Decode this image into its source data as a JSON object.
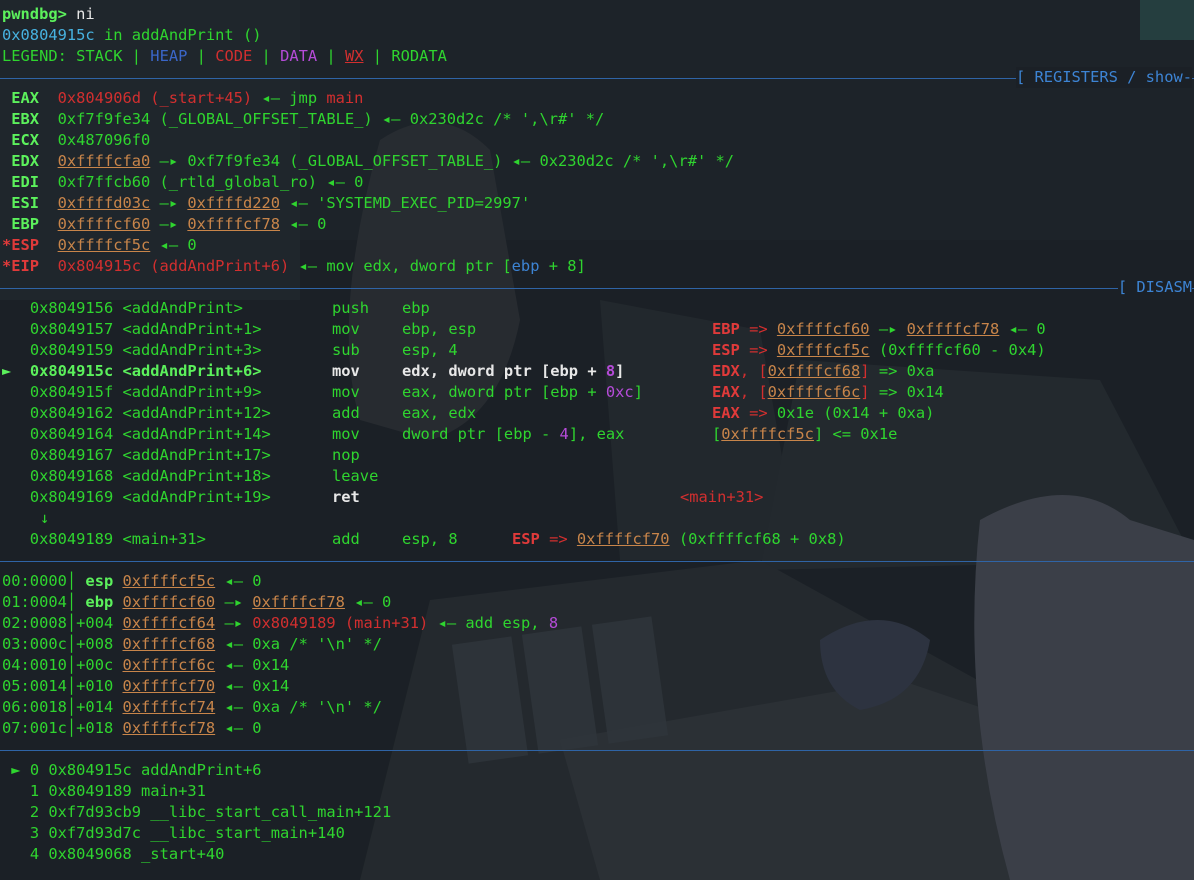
{
  "colors": {
    "stack": "#c8854a",
    "heap": "#3a66c8",
    "code": "#d22f2f",
    "data": "#b54bd8",
    "rodata": "#2fd52f",
    "separator": "#2f64a6",
    "background": "#1a1f24"
  },
  "prompt": {
    "text": "pwndbg> ",
    "command": "ni"
  },
  "location": {
    "addr": "0x0804915c",
    "in": " in ",
    "func": "addAndPrint ()"
  },
  "legend": {
    "label": "LEGEND: ",
    "stack": "STACK",
    "heap": "HEAP",
    "code": "CODE",
    "data": "DATA",
    "wx": "WX",
    "rodata": "RODATA",
    "sep": " | "
  },
  "sections": {
    "registers": "[ REGISTERS / show-",
    "disasm": "[ DISASM"
  },
  "registers": [
    {
      "name": " EAX  ",
      "parts": [
        [
          "r",
          "0x804906d (_start+45)"
        ],
        [
          "g",
          " ◂— "
        ],
        [
          "g",
          "jmp "
        ],
        [
          "r",
          "main"
        ]
      ]
    },
    {
      "name": " EBX  ",
      "parts": [
        [
          "g",
          "0xf7f9fe34 (_GLOBAL_OFFSET_TABLE_) ◂— 0x230d2c /* ',\\r#' */"
        ]
      ]
    },
    {
      "name": " ECX  ",
      "parts": [
        [
          "g",
          "0x487096f0"
        ]
      ]
    },
    {
      "name": " EDX  ",
      "parts": [
        [
          "o",
          "0xffffcfa0"
        ],
        [
          "g",
          " —▸ 0xf7f9fe34 (_GLOBAL_OFFSET_TABLE_) ◂— 0x230d2c /* ',\\r#' */"
        ]
      ]
    },
    {
      "name": " EDI  ",
      "parts": [
        [
          "g",
          "0xf7ffcb60 (_rtld_global_ro) ◂— 0"
        ]
      ]
    },
    {
      "name": " ESI  ",
      "parts": [
        [
          "o",
          "0xffffd03c"
        ],
        [
          "g",
          " —▸ "
        ],
        [
          "o",
          "0xffffd220"
        ],
        [
          "g",
          " ◂— 'SYSTEMD_EXEC_PID=2997'"
        ]
      ]
    },
    {
      "name": " EBP  ",
      "parts": [
        [
          "o",
          "0xffffcf60"
        ],
        [
          "g",
          " —▸ "
        ],
        [
          "o",
          "0xffffcf78"
        ],
        [
          "g",
          " ◂— 0"
        ]
      ]
    },
    {
      "name": "*ESP  ",
      "changed": true,
      "parts": [
        [
          "o",
          "0xffffcf5c"
        ],
        [
          "g",
          " ◂— 0"
        ]
      ]
    },
    {
      "name": "*EIP  ",
      "changed": true,
      "parts": [
        [
          "r",
          "0x804915c (addAndPrint+6)"
        ],
        [
          "g",
          " ◂— mov edx, dword ptr ["
        ],
        [
          "b",
          "ebp"
        ],
        [
          "g",
          " + 8]"
        ]
      ]
    }
  ],
  "disasm": [
    {
      "arrow": "  ",
      "addr": "0x8049156",
      "sym": "<addAndPrint>",
      "op": "push",
      "args": [
        [
          "g",
          "ebp"
        ]
      ],
      "note": []
    },
    {
      "arrow": "  ",
      "addr": "0x8049157",
      "sym": "<addAndPrint+1>",
      "op": "mov",
      "args": [
        [
          "g",
          "ebp, esp"
        ]
      ],
      "note": [
        [
          "rb",
          "EBP"
        ],
        [
          "r",
          " => "
        ],
        [
          "o",
          "0xffffcf60"
        ],
        [
          "g",
          " —▸ "
        ],
        [
          "o",
          "0xffffcf78"
        ],
        [
          "g",
          " ◂— 0"
        ]
      ]
    },
    {
      "arrow": "  ",
      "addr": "0x8049159",
      "sym": "<addAndPrint+3>",
      "op": "sub",
      "args": [
        [
          "g",
          "esp, 4"
        ]
      ],
      "note": [
        [
          "rb",
          "ESP"
        ],
        [
          "r",
          " => "
        ],
        [
          "o",
          "0xffffcf5c"
        ],
        [
          "g",
          " (0xffffcf60 - 0x4)"
        ]
      ]
    },
    {
      "arrow": "► ",
      "current": true,
      "addr": "0x804915c",
      "sym": "<addAndPrint+6>",
      "op": "mov",
      "args": [
        [
          "w",
          "edx, dword ptr ["
        ],
        [
          "w",
          "ebp"
        ],
        [
          "w",
          " + "
        ],
        [
          "pu",
          "8"
        ],
        [
          "w",
          "]"
        ]
      ],
      "note": [
        [
          "rb",
          "EDX"
        ],
        [
          "r",
          ", ["
        ],
        [
          "o",
          "0xffffcf68"
        ],
        [
          "r",
          "]"
        ],
        [
          "g",
          " => 0xa"
        ]
      ]
    },
    {
      "arrow": "  ",
      "addr": "0x804915f",
      "sym": "<addAndPrint+9>",
      "op": "mov",
      "args": [
        [
          "g",
          "eax, dword ptr ["
        ],
        [
          "g",
          "ebp"
        ],
        [
          "g",
          " + "
        ],
        [
          "pu",
          "0xc"
        ],
        [
          "g",
          "]"
        ]
      ],
      "note": [
        [
          "rb",
          "EAX"
        ],
        [
          "r",
          ", ["
        ],
        [
          "o",
          "0xffffcf6c"
        ],
        [
          "r",
          "]"
        ],
        [
          "g",
          " => 0x14"
        ]
      ]
    },
    {
      "arrow": "  ",
      "addr": "0x8049162",
      "sym": "<addAndPrint+12>",
      "op": "add",
      "args": [
        [
          "g",
          "eax, edx"
        ]
      ],
      "note": [
        [
          "rb",
          "EAX"
        ],
        [
          "r",
          " => "
        ],
        [
          "g",
          "0x1e (0x14 + 0xa)"
        ]
      ]
    },
    {
      "arrow": "  ",
      "addr": "0x8049164",
      "sym": "<addAndPrint+14>",
      "op": "mov",
      "args": [
        [
          "g",
          "dword ptr [ebp - "
        ],
        [
          "pu",
          "4"
        ],
        [
          "g",
          "], eax"
        ]
      ],
      "note": [
        [
          "g",
          "["
        ],
        [
          "o",
          "0xffffcf5c"
        ],
        [
          "g",
          "] <= 0x1e"
        ]
      ]
    },
    {
      "arrow": "  ",
      "addr": "0x8049167",
      "sym": "<addAndPrint+17>",
      "op": "nop",
      "args": [],
      "note": []
    },
    {
      "arrow": "  ",
      "addr": "0x8049168",
      "sym": "<addAndPrint+18>",
      "op": "leave",
      "args": [],
      "note": []
    },
    {
      "arrow": "  ",
      "addr": "0x8049169",
      "sym": "<addAndPrint+19>",
      "op": "ret",
      "bold": true,
      "args": [],
      "note": [
        [
          "r",
          "<main+31>"
        ]
      ],
      "noteAt": 680
    }
  ],
  "jump_arrow": "↓",
  "jump_line": {
    "addr": "0x8049189",
    "sym": "<main+31>",
    "op": "add",
    "args": "esp, 8",
    "note": [
      [
        "rb",
        "ESP"
      ],
      [
        "r",
        " => "
      ],
      [
        "o",
        "0xffffcf70"
      ],
      [
        "g",
        " (0xffffcf68 + 0x8)"
      ]
    ]
  },
  "stack": [
    {
      "idx": "00:0000",
      "off": " esp ",
      "reg": true,
      "parts": [
        [
          "o",
          "0xffffcf5c"
        ],
        [
          "g",
          " ◂— 0"
        ]
      ]
    },
    {
      "idx": "01:0004",
      "off": " ebp ",
      "reg": true,
      "parts": [
        [
          "o",
          "0xffffcf60"
        ],
        [
          "g",
          " —▸ "
        ],
        [
          "o",
          "0xffffcf78"
        ],
        [
          "g",
          " ◂— 0"
        ]
      ]
    },
    {
      "idx": "02:0008",
      "off": "+004 ",
      "parts": [
        [
          "o",
          "0xffffcf64"
        ],
        [
          "g",
          " —▸ "
        ],
        [
          "r",
          "0x8049189 (main+31)"
        ],
        [
          "g",
          " ◂— add "
        ],
        [
          "g",
          "esp"
        ],
        [
          "g",
          ", "
        ],
        [
          "pu",
          "8"
        ]
      ]
    },
    {
      "idx": "03:000c",
      "off": "+008 ",
      "parts": [
        [
          "o",
          "0xffffcf68"
        ],
        [
          "g",
          " ◂— 0xa /* '\\n' */"
        ]
      ]
    },
    {
      "idx": "04:0010",
      "off": "+00c ",
      "parts": [
        [
          "o",
          "0xffffcf6c"
        ],
        [
          "g",
          " ◂— 0x14"
        ]
      ]
    },
    {
      "idx": "05:0014",
      "off": "+010 ",
      "parts": [
        [
          "o",
          "0xffffcf70"
        ],
        [
          "g",
          " ◂— 0x14"
        ]
      ]
    },
    {
      "idx": "06:0018",
      "off": "+014 ",
      "parts": [
        [
          "o",
          "0xffffcf74"
        ],
        [
          "g",
          " ◂— 0xa /* '\\n' */"
        ]
      ]
    },
    {
      "idx": "07:001c",
      "off": "+018 ",
      "parts": [
        [
          "o",
          "0xffffcf78"
        ],
        [
          "g",
          " ◂— 0"
        ]
      ]
    }
  ],
  "backtrace": [
    {
      "arrow": " ► ",
      "n": "0",
      "addr": "0x804915c",
      "sym": "addAndPrint+6"
    },
    {
      "arrow": "   ",
      "n": "1",
      "addr": "0x8049189",
      "sym": "main+31"
    },
    {
      "arrow": "   ",
      "n": "2",
      "addr": "0xf7d93cb9",
      "sym": "__libc_start_call_main+121"
    },
    {
      "arrow": "   ",
      "n": "3",
      "addr": "0xf7d93d7c",
      "sym": "__libc_start_main+140"
    },
    {
      "arrow": "   ",
      "n": "4",
      "addr": "0x8049068",
      "sym": "_start+40"
    }
  ]
}
